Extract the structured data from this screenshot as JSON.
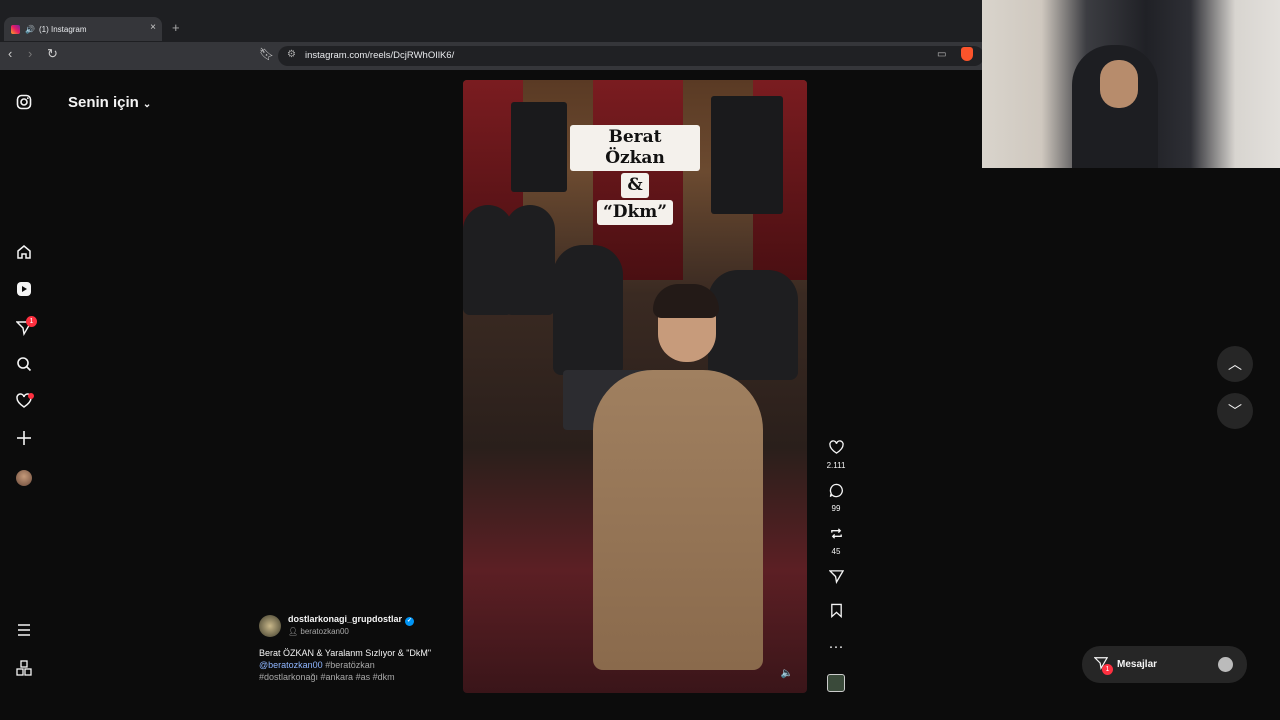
{
  "browser": {
    "tab_title": "(1) Instagram",
    "new_tab": "+",
    "url": "instagram.com/reels/DcjRWhOIlK6/",
    "close": "×"
  },
  "ig": {
    "feed_title": "Senin için",
    "nav": [
      "instagram-logo",
      "home",
      "reels",
      "messages",
      "search",
      "notifications",
      "create",
      "profile",
      "more",
      "also-from-meta"
    ],
    "messages_badge": "1"
  },
  "reel": {
    "overlay_line1": "Berat Özkan",
    "overlay_line2": "&",
    "overlay_line3": "“Dkm”",
    "account": "dostlarkonagi_grupdostlar",
    "audio": "beratozkan00",
    "caption": "Berat ÖZKAN & Yaralanm Sızlıyor & \"DkM\"",
    "mention": "@beratozkan00",
    "tag1": "#beratözkan",
    "tags_line": "#dostlarkonağı #ankara #as #dkm",
    "likes": "2.111",
    "comments": "99",
    "reposts": "45"
  },
  "messages": {
    "label": "Mesajlar",
    "badge": "1"
  },
  "icons": {
    "like": "heart-icon",
    "comment": "comment-icon",
    "repost": "repost-icon",
    "share": "send-icon",
    "save": "bookmark-icon",
    "more": "more-icon",
    "up": "chevron-up-icon",
    "down": "chevron-down-icon"
  }
}
